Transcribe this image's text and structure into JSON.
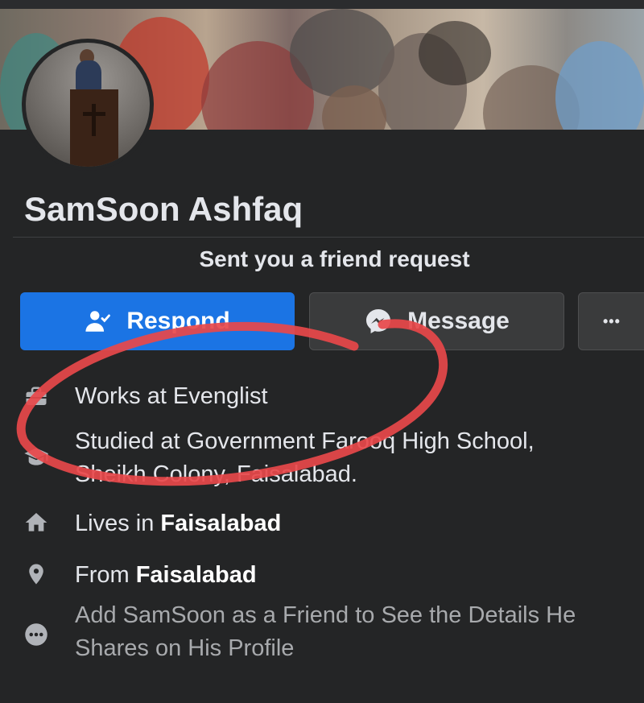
{
  "profile": {
    "name": "SamSoon Ashfaq",
    "request_text": "Sent you a friend request"
  },
  "actions": {
    "respond_label": "Respond",
    "message_label": "Message",
    "more_label": "•••"
  },
  "details": {
    "work": "Works at Evenglist",
    "education_line1": "Studied at Government Farooq High School,",
    "education_line2": "Sheikh Colony, Faisalabad.",
    "lives_prefix": "Lives in ",
    "lives_city": "Faisalabad",
    "from_prefix": "From ",
    "from_city": "Faisalabad",
    "friend_note_line1": "Add SamSoon as a Friend to See the Details He",
    "friend_note_line2": "Shares on His Profile"
  },
  "icons": {
    "respond": "person-check-icon",
    "message": "messenger-icon",
    "work": "briefcase-icon",
    "education": "graduation-cap-icon",
    "lives": "home-icon",
    "from": "location-pin-icon",
    "more_info": "more-dots-icon"
  },
  "colors": {
    "background": "#242526",
    "primary_button": "#1b74e4",
    "secondary_button": "#3a3b3c",
    "annotation": "#e8484a"
  }
}
